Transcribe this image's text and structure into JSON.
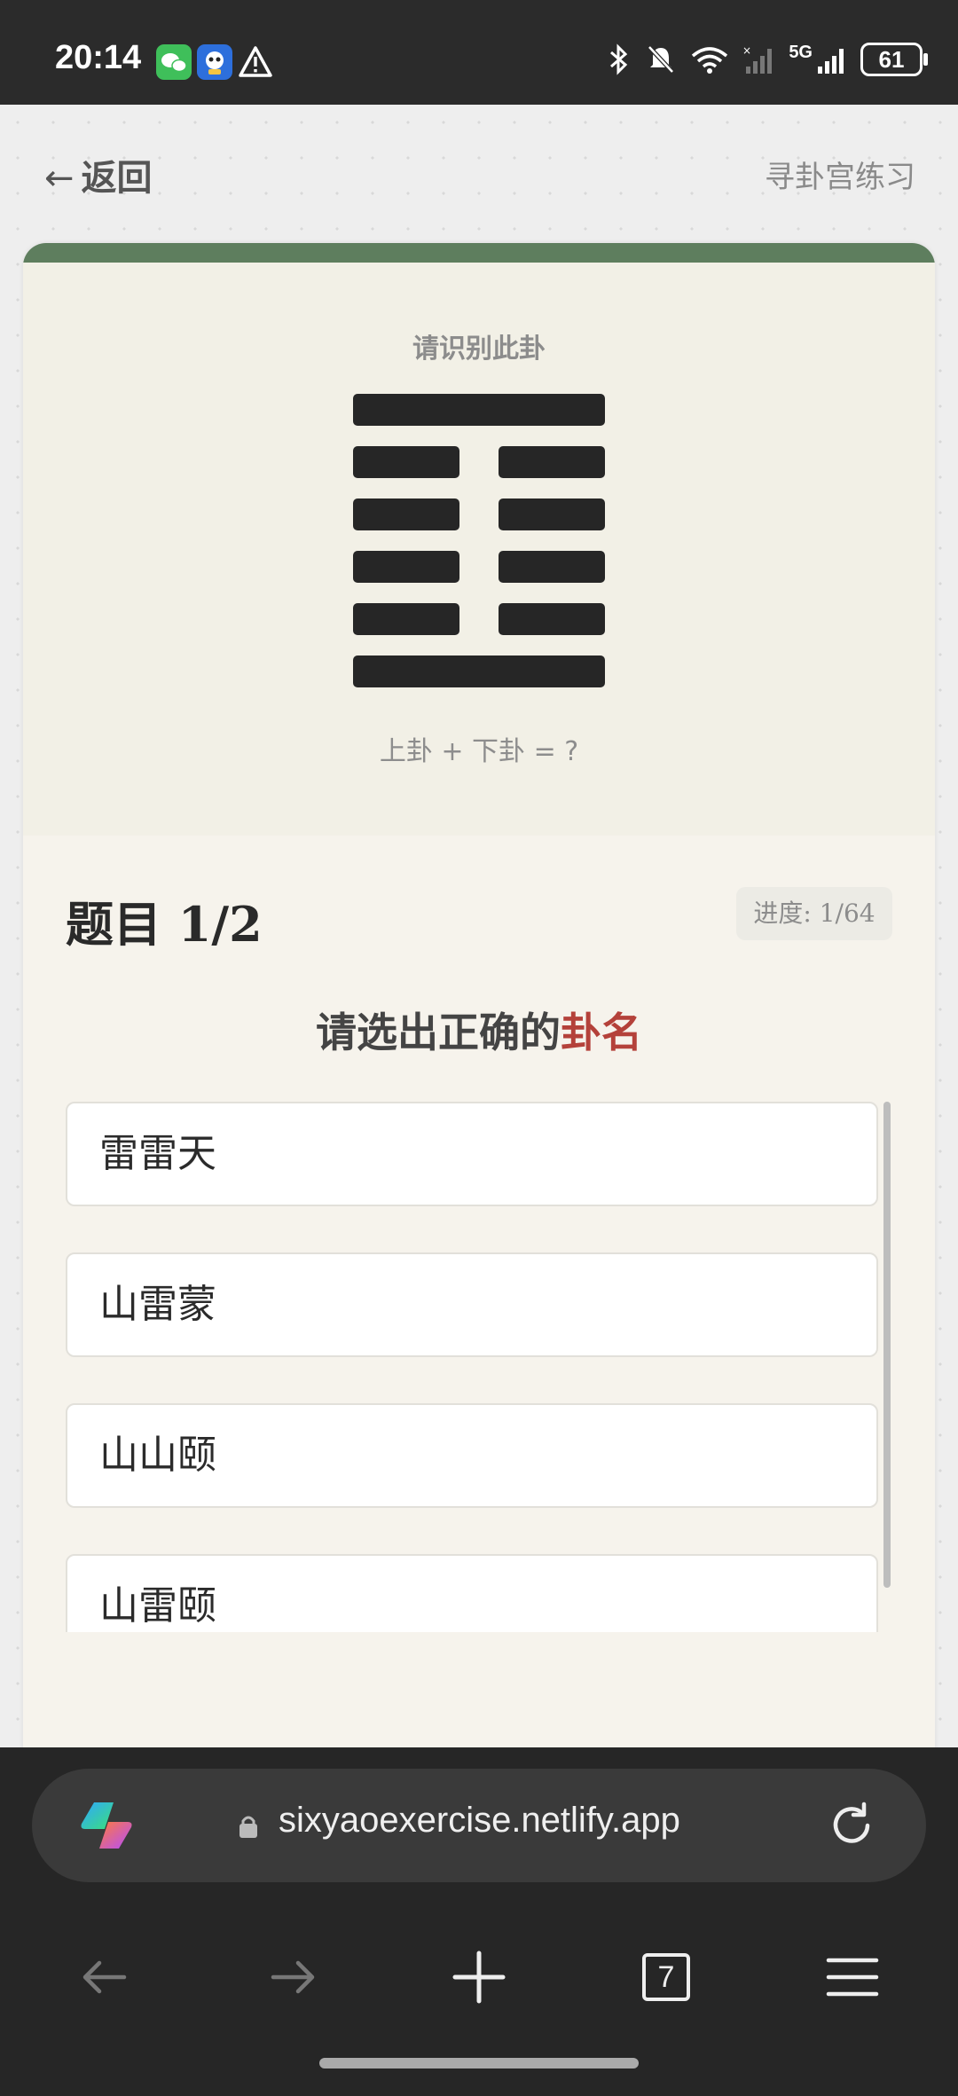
{
  "status_bar": {
    "time": "20:14",
    "network_label": "5G",
    "battery": "61"
  },
  "header": {
    "back_label": "返回",
    "title": "寻卦宫练习"
  },
  "hexagram": {
    "prompt": "请识别此卦",
    "lines_top_to_bottom": [
      "yang",
      "yin",
      "yin",
      "yin",
      "yin",
      "yang"
    ],
    "formula": "上卦 + 下卦 = ?"
  },
  "question": {
    "title": "题目 1/2",
    "progress": "进度: 1/64",
    "instruction_prefix": "请选出正确的",
    "instruction_highlight": "卦名"
  },
  "options": [
    {
      "label": "雷雷天"
    },
    {
      "label": "山雷蒙"
    },
    {
      "label": "山山颐"
    },
    {
      "label": "山雷颐"
    }
  ],
  "browser": {
    "url": "sixyaoexercise.netlify.app",
    "tab_count": "7"
  },
  "colors": {
    "accent_green": "#5e7e5e",
    "highlight_red": "#b4413a",
    "card_bg": "#f4f1e8"
  }
}
